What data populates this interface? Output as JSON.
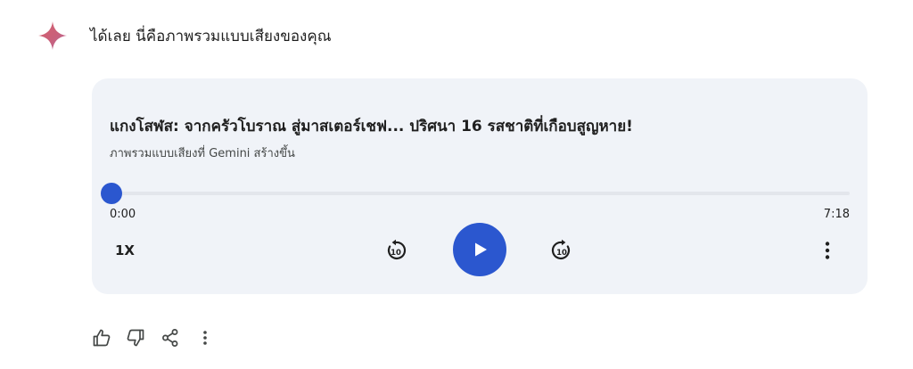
{
  "assistant": {
    "icon": "gemini-spark-icon",
    "spark_color_top": "#4f7ae0",
    "spark_color_bottom": "#d65f6d",
    "message": "ได้เลย นี่คือภาพรวมแบบเสียงของคุณ"
  },
  "audio_card": {
    "title": "แกงโสฬส: จากครัวโบราณ สู่มาสเตอร์เชฟ... ปริศนา 16 รสชาติที่เกือบสูญหาย!",
    "subtitle": "ภาพรวมแบบเสียงที่ Gemini สร้างขึ้น",
    "current_time": "0:00",
    "duration": "7:18",
    "progress": 0,
    "speed_label": "1X",
    "rewind_seconds": "10",
    "forward_seconds": "10",
    "play_icon": "play-icon",
    "more_icon": "more-vert-icon",
    "accent_color": "#2b57cf",
    "card_background": "#f0f3f8"
  },
  "feedback_actions": {
    "icons": [
      "thumb-up-icon",
      "thumb-down-icon",
      "share-icon",
      "more-vert-icon"
    ]
  }
}
